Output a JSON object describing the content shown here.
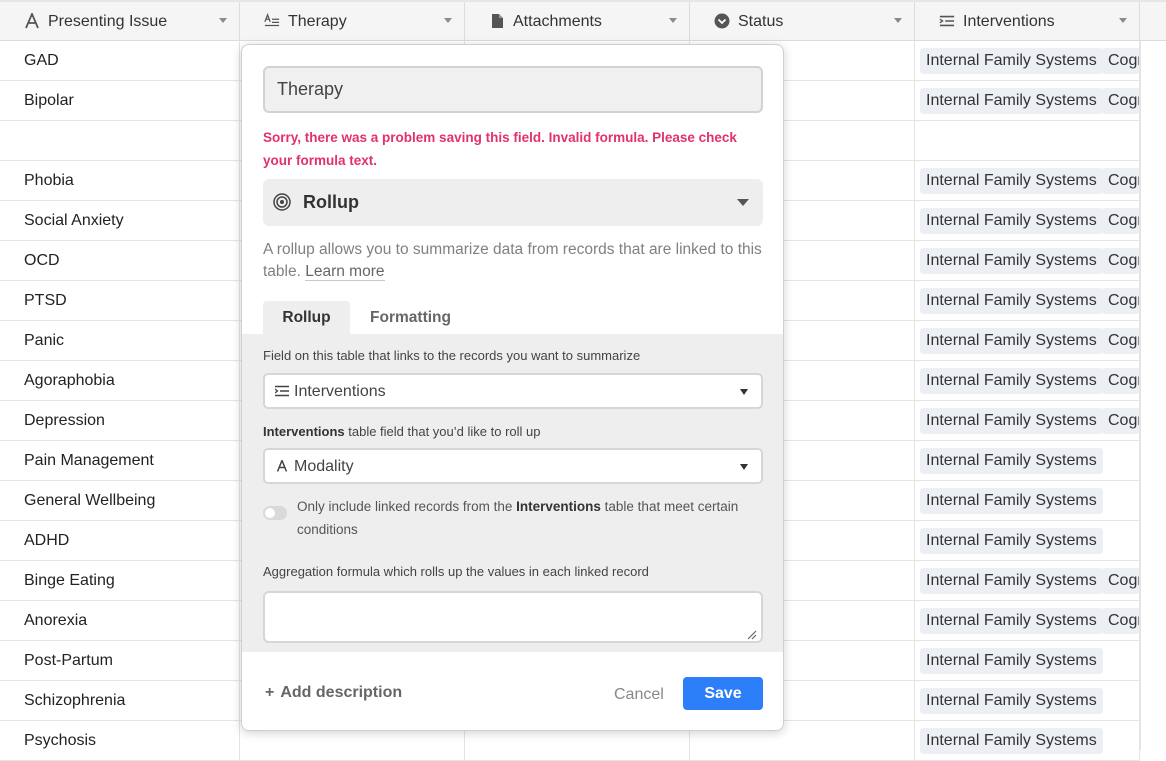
{
  "columns": [
    {
      "label": "Presenting Issue",
      "icon": "text-icon"
    },
    {
      "label": "Therapy",
      "icon": "formula-lines-icon"
    },
    {
      "label": "Attachments",
      "icon": "document-icon"
    },
    {
      "label": "Status",
      "icon": "status-chevron-icon"
    },
    {
      "label": "Interventions",
      "icon": "linked-list-icon"
    }
  ],
  "rows": [
    {
      "issue": "GAD",
      "tags": [
        "Internal Family Systems",
        "Cognitive"
      ]
    },
    {
      "issue": "Bipolar",
      "tags": [
        "Internal Family Systems",
        "Cognitive"
      ]
    },
    {
      "issue": "",
      "tags": []
    },
    {
      "issue": "Phobia",
      "tags": [
        "Internal Family Systems",
        "Cognitive"
      ]
    },
    {
      "issue": "Social Anxiety",
      "tags": [
        "Internal Family Systems",
        "Cognitive"
      ]
    },
    {
      "issue": "OCD",
      "tags": [
        "Internal Family Systems",
        "Cognitive"
      ]
    },
    {
      "issue": "PTSD",
      "tags": [
        "Internal Family Systems",
        "Cognitive"
      ]
    },
    {
      "issue": "Panic",
      "tags": [
        "Internal Family Systems",
        "Cognitive"
      ]
    },
    {
      "issue": "Agoraphobia",
      "tags": [
        "Internal Family Systems",
        "Cognitive"
      ]
    },
    {
      "issue": "Depression",
      "tags": [
        "Internal Family Systems",
        "Cognitive"
      ]
    },
    {
      "issue": "Pain Management",
      "tags": [
        "Internal Family Systems"
      ]
    },
    {
      "issue": "General Wellbeing",
      "tags": [
        "Internal Family Systems"
      ]
    },
    {
      "issue": "ADHD",
      "tags": [
        "Internal Family Systems"
      ]
    },
    {
      "issue": "Binge Eating",
      "tags": [
        "Internal Family Systems",
        "Cognitive"
      ]
    },
    {
      "issue": "Anorexia",
      "tags": [
        "Internal Family Systems",
        "Cognitive"
      ]
    },
    {
      "issue": "Post-Partum",
      "tags": [
        "Internal Family Systems"
      ]
    },
    {
      "issue": "Schizophrenia",
      "tags": [
        "Internal Family Systems"
      ]
    },
    {
      "issue": "Psychosis",
      "tags": [
        "Internal Family Systems"
      ]
    }
  ],
  "dialog": {
    "field_name": "Therapy",
    "error": "Sorry, there was a problem saving this field. Invalid formula. Please check your formula text.",
    "field_type": "Rollup",
    "help_text": "A rollup allows you to summarize data from records that are linked to this table.",
    "learn_more": "Learn more",
    "tabs": [
      "Rollup",
      "Formatting"
    ],
    "link_label": "Field on this table that links to the records you want to summarize",
    "link_value": "Interventions",
    "rollup_label_bold": "Interventions",
    "rollup_label_rest": "table field that you’d like to roll up",
    "rollup_value": "Modality",
    "condition_prefix": "Only include linked records from the",
    "condition_bold": "Interventions",
    "condition_suffix": "table that meet certain conditions",
    "condition_enabled": false,
    "aggregation_label": "Aggregation formula which rolls up the values in each linked record",
    "aggregation_value": "",
    "add_description": "Add description",
    "cancel": "Cancel",
    "save": "Save"
  },
  "colors": {
    "accent": "#2d7ff9",
    "error": "#e2316b",
    "tag_bg": "#eceff3"
  }
}
